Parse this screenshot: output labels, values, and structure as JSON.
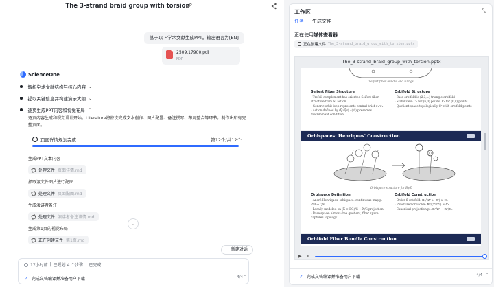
{
  "header": {
    "title": "The 3-strand braid group with torsion"
  },
  "chat": {
    "user_message": "基于以下学术文献生成PPT。输出语言为[EN]",
    "attachment": {
      "name": "2509.17900.pdf",
      "type": "PDF"
    },
    "assistant_name": "ScienceOne",
    "steps": [
      {
        "label": "解析学术文献结构与核心内容",
        "chevron": "⌄"
      },
      {
        "label": "提取关键信息并构建演示大纲",
        "chevron": "⌄"
      },
      {
        "label": "逐页生成PPT内容和视觉布局",
        "chevron": "⌃"
      }
    ],
    "step_description": "逐页内容生成和视觉设计开始。Literature将依次完成文本创作、图片配置、备注撰写、布局整合等环节。制作出所有完整页面。",
    "progress": {
      "title": "页面详情规划完成",
      "count": "第12个/共12个",
      "fraction": 1.0
    },
    "subtasks": [
      {
        "label": "生成PPT文本内容",
        "action": "处理文件",
        "file": "页面详情.md"
      },
      {
        "label": "抓取源文件图片进行配图",
        "action": "处理文件",
        "file": "页面配图.md"
      },
      {
        "label": "生成演讲者备注",
        "action": "处理文件",
        "file": "演讲者备注详情.md"
      },
      {
        "label": "生成第1页的视觉布局",
        "action": "正在创建文件",
        "file": "第1页.md"
      }
    ],
    "scroll_down_icon": "chevron-down-icon",
    "new_chat_label": "+ 新建对话",
    "status": {
      "summary": [
        "17小时前",
        "已规划 4 个步骤",
        "已完成"
      ],
      "current": "完成文档编译并准备用户下载",
      "count": "4/4"
    }
  },
  "workspace": {
    "title": "工作区",
    "tabs": [
      "任务",
      "生成文件"
    ],
    "active_tab": 0,
    "viewer_prefix": "正在使用",
    "viewer_name": "媒体查看器",
    "creating_label": "正在创建文件",
    "creating_file": "The_3-strand_braid_group_with_torsion.pptx",
    "pptx_name": "The_3-strand_braid_group_with_torsion.pptx",
    "slide_top": {
      "caption": "Seifert fiber bundle and tilings",
      "left_heading": "Seifert Fiber Structure",
      "left_items": [
        "- Trefoil complement has oriented Seifert fiber structure from S¹ action",
        "- Generic orbit loop represents central brief σ₁²σ₂",
        "- Action defined by (ξu,ξv) · (²⁄₃) preserves discriminant condition"
      ],
      "right_heading": "Orbifold Structure",
      "right_items": [
        "- Base orbifold is (2,3,∞) triangle orbifold",
        "- Stabilizers: C₂ for (u,0) points, C₃ for (0,v) points",
        "- Quotient space topologically C² with orbifold points"
      ]
    },
    "slide_mid": {
      "title": "Orbispaces: Henriques' Construction",
      "caption": "Orbispace structure for B₃/Z",
      "left_heading": "Orbispace Definition",
      "left_items": [
        "- André Henriques' orbispace: continuous map p: PM → QM",
        "- Locally modeled on (X × EG)/G → X/G projection",
        "- Base space: almost-free quotient, fiber space: captures topology"
      ],
      "right_heading": "Orbifold Construction",
      "right_items": [
        "- Order-6 orbifold: ℝ²/(ℤ² ⋊ ℤ⁶) ≅ ℂ₆",
        "- Punctured orbifolds: ℝ²/(ℤ²/ℤ²) ≅ ℂ₆",
        "- Canonical projection p₂: ℝ²/ℤ³ → ℝ²/ℂ₆"
      ]
    },
    "slide_bottom": {
      "title": "Orbifold Fiber Bundle Construction"
    },
    "status": {
      "current": "完成文档编译并准备用户下载",
      "count": "4/4"
    },
    "colors": {
      "accent": "#2f6bff",
      "slide_header": "#1c2a55"
    }
  }
}
